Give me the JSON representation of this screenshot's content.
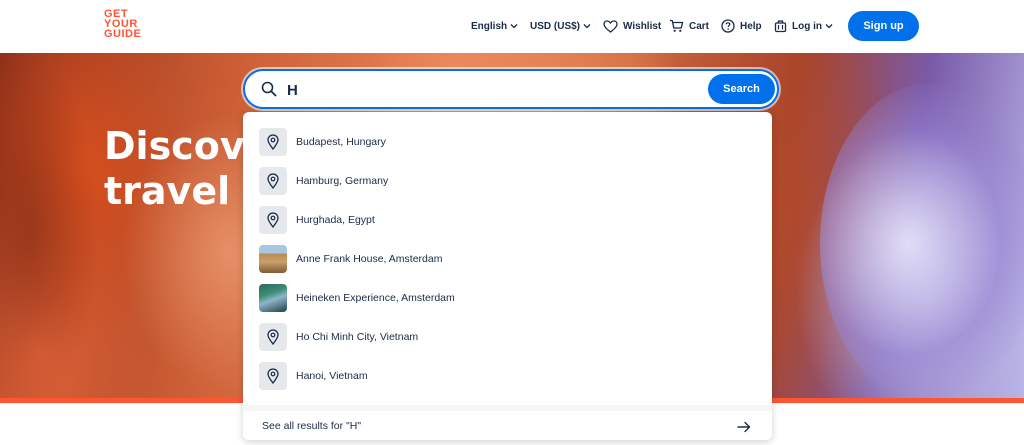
{
  "header": {
    "logo_lines": [
      "GET",
      "YOUR",
      "GUIDE"
    ],
    "language": "English",
    "currency": "USD (US$)",
    "wishlist": "Wishlist",
    "cart": "Cart",
    "help": "Help",
    "login": "Log in",
    "signup": "Sign up"
  },
  "hero": {
    "title_line1": "Discove",
    "title_line2": "travel e"
  },
  "search": {
    "value": "H",
    "button": "Search"
  },
  "suggestions": [
    {
      "label": "Budapest, Hungary",
      "icon": "location-pin-icon"
    },
    {
      "label": "Hamburg, Germany",
      "icon": "location-pin-icon"
    },
    {
      "label": "Hurghada, Egypt",
      "icon": "location-pin-icon"
    },
    {
      "label": "Anne Frank House, Amsterdam",
      "icon": "photo-thumbnail"
    },
    {
      "label": "Heineken Experience, Amsterdam",
      "icon": "photo-thumbnail"
    },
    {
      "label": "Ho Chi Minh City, Vietnam",
      "icon": "location-pin-icon"
    },
    {
      "label": "Hanoi, Vietnam",
      "icon": "location-pin-icon"
    }
  ],
  "see_all": "See all results for \"H\"",
  "colors": {
    "brand": "#ff5533",
    "primary": "#0071eb",
    "text": "#1a2b49"
  }
}
